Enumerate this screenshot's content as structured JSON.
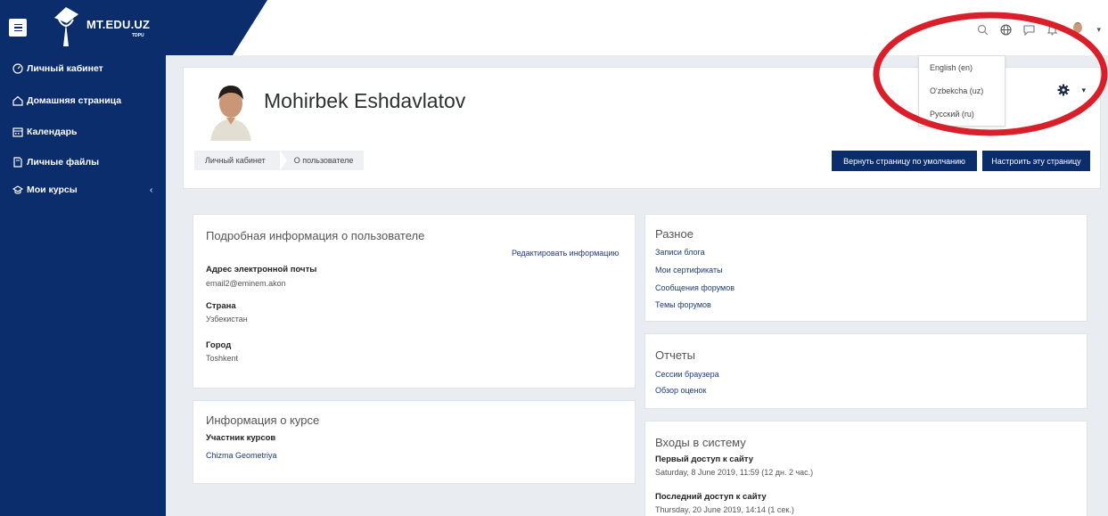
{
  "brand": {
    "name": "MT.EDU.UZ",
    "sub": "TDPU"
  },
  "topbar_icons": [
    "search-icon",
    "globe-icon",
    "chat-icon",
    "bell-icon",
    "user-avatar"
  ],
  "sidebar": {
    "items": [
      {
        "label": "Личный кабинет",
        "icon": "dashboard-icon"
      },
      {
        "label": "Домашняя страница",
        "icon": "home-icon"
      },
      {
        "label": "Календарь",
        "icon": "calendar-icon"
      },
      {
        "label": "Личные файлы",
        "icon": "files-icon"
      },
      {
        "label": "Мои курсы",
        "icon": "graduation-cap-icon"
      }
    ],
    "collapse_glyph": "‹"
  },
  "header": {
    "user_name": "Mohirbek Eshdavlatov",
    "breadcrumb": [
      "Личный кабинет",
      "О пользователе"
    ],
    "btn_reset": "Вернуть страницу по умолчанию",
    "btn_customize": "Настроить эту страницу"
  },
  "language_menu": {
    "items": [
      "English (en)",
      "O'zbekcha (uz)",
      "Русский (ru)"
    ]
  },
  "user_details": {
    "title": "Подробная информация о пользователе",
    "edit_link": "Редактировать информацию",
    "email_label": "Адрес электронной почты",
    "email_value": "email2@eminem.akon",
    "country_label": "Страна",
    "country_value": "Узбекистан",
    "city_label": "Город",
    "city_value": "Toshkent"
  },
  "course_details": {
    "title": "Информация о курсе",
    "label": "Участник курсов",
    "course": "Chizma Geometriya"
  },
  "misc": {
    "title": "Разное",
    "links": [
      "Записи блога",
      "Мои сертификаты",
      "Сообщения форумов",
      "Темы форумов"
    ]
  },
  "reports": {
    "title": "Отчеты",
    "links": [
      "Сессии браузера",
      "Обзор оценок"
    ]
  },
  "logins": {
    "title": "Входы в систему",
    "first_label": "Первый доступ к сайту",
    "first_value": "Saturday, 8 June 2019, 11:59  (12 дн. 2 час.)",
    "last_label": "Последний доступ к сайту",
    "last_value": "Thursday, 20 June 2019, 14:14  (1 сек.)"
  },
  "colors": {
    "brand": "#0b2d6b",
    "highlight": "#d9202a"
  }
}
